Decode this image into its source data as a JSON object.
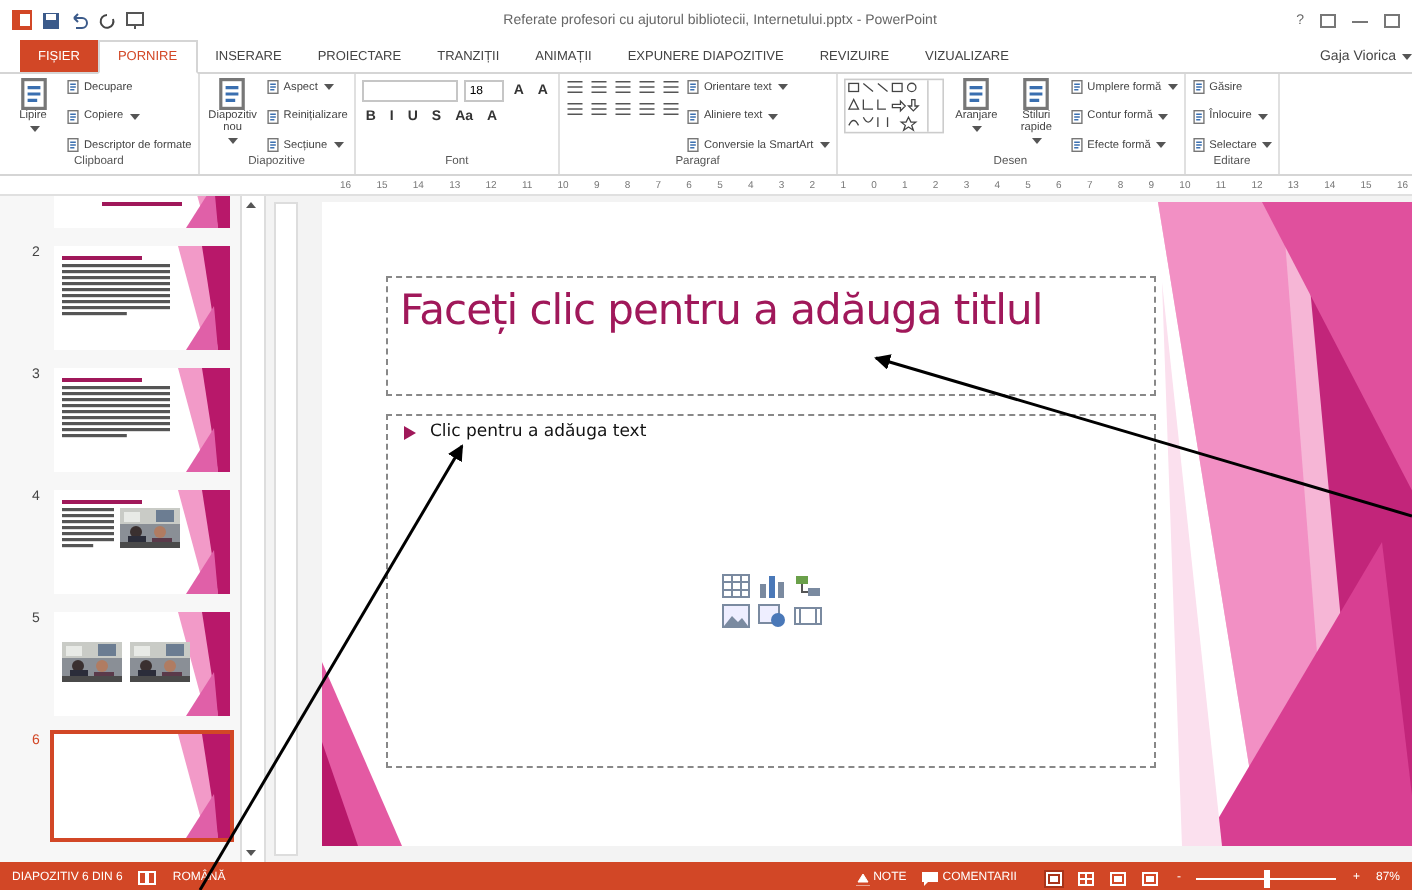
{
  "window": {
    "title": "Referate profesori cu ajutorul bibliotecii, Internetului.pptx - PowerPoint",
    "help": "?",
    "user": "Gaja Viorica"
  },
  "tabs": [
    {
      "label": "FIȘIER",
      "kind": "file",
      "selected": false
    },
    {
      "label": "PORNIRE",
      "kind": "tab",
      "selected": true
    },
    {
      "label": "INSERARE",
      "kind": "tab",
      "selected": false
    },
    {
      "label": "PROIECTARE",
      "kind": "tab",
      "selected": false
    },
    {
      "label": "TRANZIȚII",
      "kind": "tab",
      "selected": false
    },
    {
      "label": "ANIMAȚII",
      "kind": "tab",
      "selected": false
    },
    {
      "label": "EXPUNERE DIAPOZITIVE",
      "kind": "tab",
      "selected": false
    },
    {
      "label": "REVIZUIRE",
      "kind": "tab",
      "selected": false
    },
    {
      "label": "VIZUALIZARE",
      "kind": "tab",
      "selected": false
    }
  ],
  "ribbon": [
    {
      "label": "Clipboard",
      "sections": [
        {
          "kind": "large",
          "label": "Lipire",
          "dropdown": true
        },
        {
          "kind": "stack",
          "items": [
            {
              "label": "Decupare",
              "dropdown": false
            },
            {
              "label": "Copiere",
              "dropdown": true
            },
            {
              "label": "Descriptor de formate",
              "dropdown": false
            }
          ]
        }
      ]
    },
    {
      "label": "Diapozitive",
      "sections": [
        {
          "kind": "large",
          "label": "Diapozitiv nou",
          "dropdown": true
        },
        {
          "kind": "stack",
          "items": [
            {
              "label": "Aspect",
              "dropdown": true
            },
            {
              "label": "Reinițializare",
              "dropdown": false
            },
            {
              "label": "Secțiune",
              "dropdown": true
            }
          ]
        }
      ]
    },
    {
      "label": "Font",
      "sections": [
        {
          "kind": "rows",
          "rows": [
            [
              {
                "kind": "field",
                "wide": true
              },
              {
                "kind": "field",
                "value": "18",
                "wide": false
              },
              {
                "kind": "glyph",
                "text": "A"
              },
              {
                "kind": "glyph",
                "text": "A"
              }
            ],
            [
              {
                "kind": "glyph",
                "text": "B"
              },
              {
                "kind": "glyph",
                "text": "I"
              },
              {
                "kind": "glyph",
                "text": "U"
              },
              {
                "kind": "glyph",
                "text": "S"
              },
              {
                "kind": "glyph",
                "text": "Aa"
              },
              {
                "kind": "glyph",
                "text": "A"
              }
            ]
          ]
        }
      ]
    },
    {
      "label": "Paragraf",
      "sections": [
        {
          "kind": "rows",
          "rows": [
            [
              {
                "kind": "icon"
              },
              {
                "kind": "icon"
              },
              {
                "kind": "icon"
              },
              {
                "kind": "icon"
              },
              {
                "kind": "icon"
              }
            ],
            [
              {
                "kind": "icon"
              },
              {
                "kind": "icon"
              },
              {
                "kind": "icon"
              },
              {
                "kind": "icon"
              },
              {
                "kind": "icon"
              }
            ]
          ]
        },
        {
          "kind": "stack",
          "items": [
            {
              "label": "Orientare text",
              "dropdown": true
            },
            {
              "label": "Aliniere text",
              "dropdown": true
            },
            {
              "label": "Conversie la SmartArt",
              "dropdown": true
            }
          ]
        }
      ]
    },
    {
      "label": "Desen",
      "sections": [
        {
          "kind": "gallery"
        },
        {
          "kind": "large",
          "label": "Aranjare",
          "dropdown": true
        },
        {
          "kind": "large",
          "label": "Stiluri rapide",
          "dropdown": true
        },
        {
          "kind": "stack",
          "items": [
            {
              "label": "Umplere formă",
              "dropdown": true
            },
            {
              "label": "Contur formă",
              "dropdown": true
            },
            {
              "label": "Efecte formă",
              "dropdown": true
            }
          ]
        }
      ]
    },
    {
      "label": "Editare",
      "sections": [
        {
          "kind": "stack",
          "items": [
            {
              "label": "Găsire",
              "dropdown": false
            },
            {
              "label": "Înlocuire",
              "dropdown": true
            },
            {
              "label": "Selectare",
              "dropdown": true
            }
          ]
        }
      ]
    }
  ],
  "ruler": [
    "16",
    "15",
    "14",
    "13",
    "12",
    "11",
    "10",
    "9",
    "8",
    "7",
    "6",
    "5",
    "4",
    "3",
    "2",
    "1",
    "0",
    "1",
    "2",
    "3",
    "4",
    "5",
    "6",
    "7",
    "8",
    "9",
    "10",
    "11",
    "12",
    "13",
    "14",
    "15",
    "16"
  ],
  "thumbnails": [
    {
      "kind": "title",
      "selected": false
    },
    {
      "number": "2",
      "kind": "text",
      "selected": false
    },
    {
      "number": "3",
      "kind": "text",
      "selected": false
    },
    {
      "number": "4",
      "kind": "photo-text",
      "selected": false
    },
    {
      "number": "5",
      "kind": "photos",
      "selected": false
    },
    {
      "number": "6",
      "kind": "blank",
      "selected": true
    }
  ],
  "slide": {
    "title_placeholder": "Faceți clic pentru a adăuga titlul",
    "text_placeholder": "Clic pentru a adăuga text"
  },
  "status_bar": {
    "slide": "DIAPOZITIV 6 DIN 6",
    "language": "ROMÂNĂ",
    "notes": "NOTE",
    "comments": "COMENTARII",
    "views": [
      {
        "selected": true
      },
      {
        "selected": false
      },
      {
        "selected": false
      },
      {
        "selected": false
      }
    ],
    "zoom_out": "-",
    "zoom_in": "+",
    "zoom": {
      "level": 0.5
    },
    "zoom_text": "87%"
  }
}
